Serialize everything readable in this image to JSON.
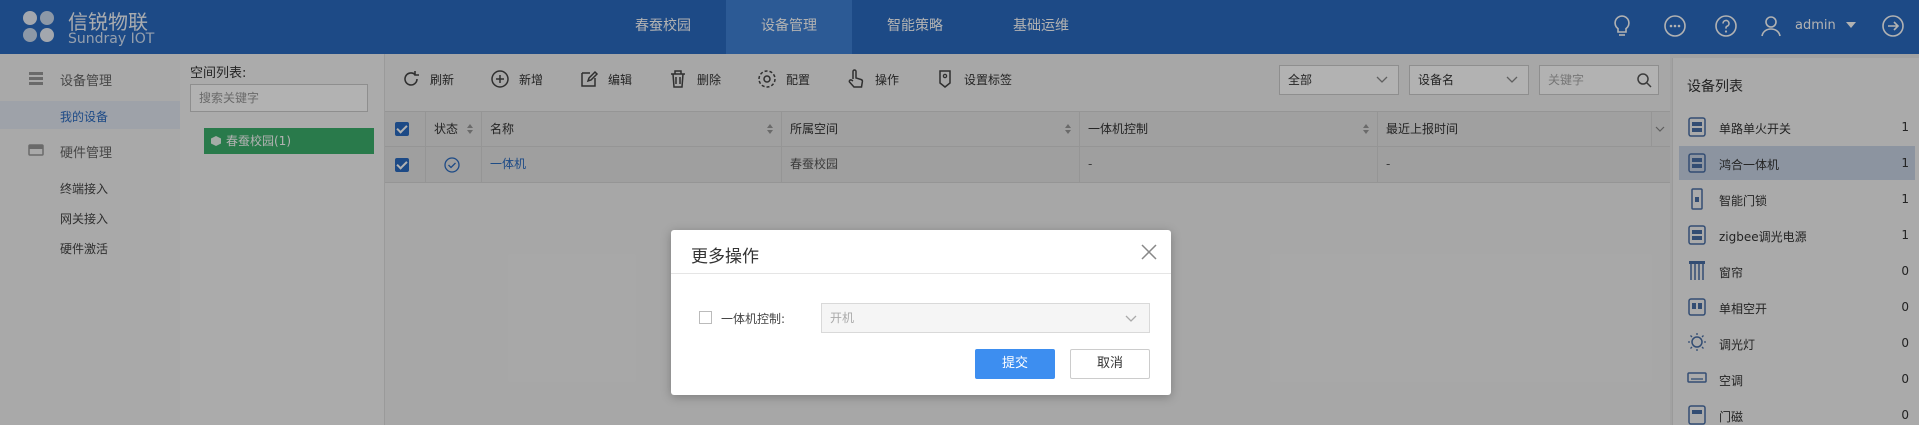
{
  "header": {
    "brand_name": "信锐物联",
    "brand_sub": "Sundray IOT",
    "nav": [
      {
        "label": "春蚕校园",
        "active": false
      },
      {
        "label": "设备管理",
        "active": true
      },
      {
        "label": "智能策略",
        "active": false
      },
      {
        "label": "基础运维",
        "active": false
      }
    ],
    "icons": [
      "lightbulb-icon",
      "chat-icon",
      "help-icon",
      "user-icon",
      "logout-icon"
    ],
    "user": "admin",
    "colors": {
      "bar": "#2a6bc1",
      "active_tab": "#3f82d6"
    }
  },
  "sidebar": {
    "groups": [
      {
        "label": "设备管理",
        "icon": "device-list-icon",
        "items": [
          {
            "label": "我的设备",
            "active": true
          }
        ]
      },
      {
        "label": "硬件管理",
        "icon": "hardware-icon",
        "items": [
          {
            "label": "终端接入"
          },
          {
            "label": "网关接入"
          },
          {
            "label": "硬件激活"
          }
        ]
      }
    ]
  },
  "space": {
    "title": "空间列表:",
    "search_placeholder": "搜索关键字",
    "tree_node": "春蚕校园(1)"
  },
  "toolbar": {
    "buttons": [
      {
        "label": "刷新",
        "icon": "refresh-icon"
      },
      {
        "label": "新增",
        "icon": "add-circle-icon"
      },
      {
        "label": "编辑",
        "icon": "edit-icon"
      },
      {
        "label": "删除",
        "icon": "trash-icon"
      },
      {
        "label": "配置",
        "icon": "gear-icon"
      },
      {
        "label": "操作",
        "icon": "hand-pointer-icon"
      },
      {
        "label": "设置标签",
        "icon": "tag-icon"
      }
    ],
    "filter_scope": "全部",
    "filter_field": "设备名",
    "search_placeholder": "关键字"
  },
  "table": {
    "columns": [
      "状态",
      "名称",
      "所属空间",
      "一体机控制",
      "最近上报时间"
    ],
    "rows": [
      {
        "checked": true,
        "status": "online",
        "name": "一体机",
        "space": "春蚕校园",
        "control": "-",
        "last_report": "-"
      }
    ]
  },
  "device_list": {
    "title": "设备列表",
    "items": [
      {
        "name": "单路单火开关",
        "count": "1",
        "icon": "switch-icon"
      },
      {
        "name": "鸿合一体机",
        "count": "1",
        "icon": "all-in-one-icon",
        "selected": true
      },
      {
        "name": "智能门锁",
        "count": "1",
        "icon": "door-lock-icon"
      },
      {
        "name": "zigbee调光电源",
        "count": "1",
        "icon": "dimmer-power-icon"
      },
      {
        "name": "窗帘",
        "count": "0",
        "icon": "curtain-icon"
      },
      {
        "name": "单相空开",
        "count": "0",
        "icon": "breaker-icon"
      },
      {
        "name": "调光灯",
        "count": "0",
        "icon": "dimmable-light-icon"
      },
      {
        "name": "空调",
        "count": "0",
        "icon": "air-conditioner-icon"
      },
      {
        "name": "门磁",
        "count": "0",
        "icon": "door-sensor-icon"
      }
    ]
  },
  "modal": {
    "title": "更多操作",
    "option_label": "一体机控制:",
    "select_value": "开机",
    "submit": "提交",
    "cancel": "取消",
    "colors": {
      "primary": "#3d8ef0"
    }
  }
}
